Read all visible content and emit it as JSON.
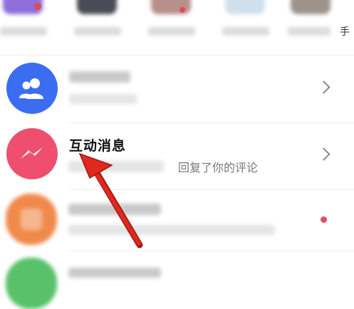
{
  "top_strip": {
    "edge_char": "手"
  },
  "rows": [
    {
      "key": "group",
      "icon": "group-icon",
      "accent": "#3b6df0"
    },
    {
      "key": "interaction",
      "icon": "messenger-bolt-icon",
      "accent": "#ef4f6f",
      "title": "互动消息",
      "subtitle": "回复了你的评论"
    },
    {
      "key": "user-orange",
      "accent": "#f08a4b",
      "has_unread": true
    },
    {
      "key": "user-green",
      "accent": "#58c16a"
    }
  ],
  "annotation": {
    "type": "red-arrow",
    "color": "#e0281e"
  }
}
